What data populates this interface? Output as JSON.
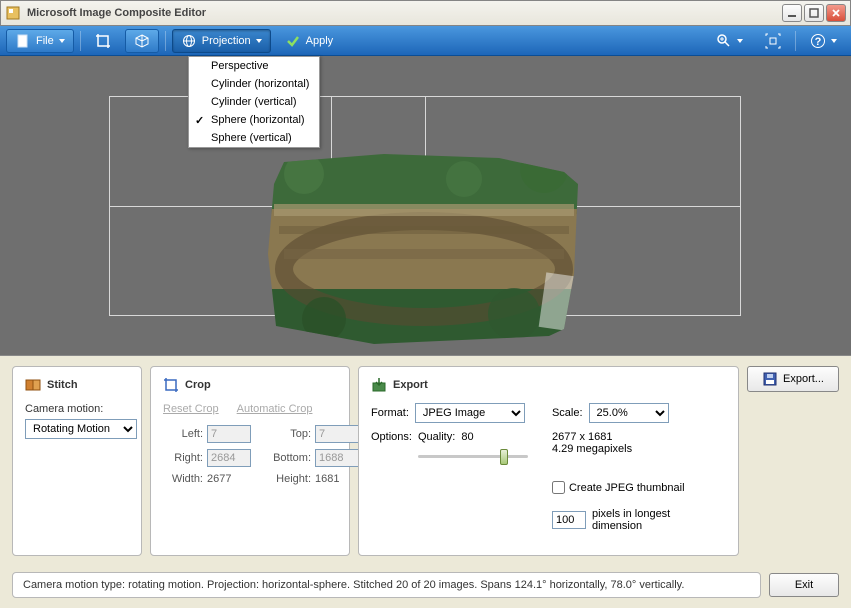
{
  "window": {
    "title": "Microsoft Image Composite Editor"
  },
  "toolbar": {
    "file": "File",
    "projection": "Projection",
    "apply": "Apply"
  },
  "projection_menu": {
    "items": [
      {
        "label": "Perspective",
        "checked": false
      },
      {
        "label": "Cylinder (horizontal)",
        "checked": false
      },
      {
        "label": "Cylinder (vertical)",
        "checked": false
      },
      {
        "label": "Sphere (horizontal)",
        "checked": true
      },
      {
        "label": "Sphere (vertical)",
        "checked": false
      }
    ]
  },
  "stitch": {
    "title": "Stitch",
    "camera_motion_label": "Camera motion:",
    "camera_motion_value": "Rotating Motion"
  },
  "crop": {
    "title": "Crop",
    "reset": "Reset Crop",
    "auto": "Automatic Crop",
    "left_label": "Left:",
    "left": "7",
    "top_label": "Top:",
    "top": "7",
    "right_label": "Right:",
    "right": "2684",
    "bottom_label": "Bottom:",
    "bottom": "1688",
    "width_label": "Width:",
    "width": "2677",
    "height_label": "Height:",
    "height": "1681"
  },
  "export": {
    "title": "Export",
    "button": "Export...",
    "format_label": "Format:",
    "format_value": "JPEG Image",
    "options_label": "Options:",
    "quality_label": "Quality:",
    "quality_value": "80",
    "scale_label": "Scale:",
    "scale_value": "25.0%",
    "dimensions": "2677 x 1681",
    "megapixels": "4.29 megapixels",
    "thumbnail_label": "Create JPEG thumbnail",
    "thumb_px": "100",
    "thumb_caption": "pixels in longest dimension"
  },
  "status": {
    "text": "Camera motion type: rotating motion. Projection: horizontal-sphere. Stitched 20 of 20 images. Spans 124.1° horizontally, 78.0° vertically.",
    "exit": "Exit"
  }
}
